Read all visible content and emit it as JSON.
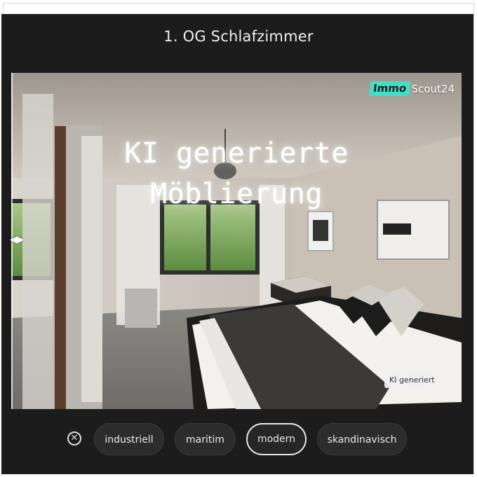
{
  "room": {
    "title": "1. OG Schlafzimmer"
  },
  "photo": {
    "brand_part1": "Immo",
    "brand_part2": "Scout24",
    "overlay_line1": "KI generierte",
    "overlay_line2": "Möblierung",
    "compare_arrows": "◀▶",
    "badge": "KI generiert"
  },
  "styles": {
    "close_icon": "close-circle-icon",
    "close_glyph": "✕",
    "options": [
      {
        "label": "industriell",
        "selected": false
      },
      {
        "label": "maritim",
        "selected": false
      },
      {
        "label": "modern",
        "selected": true
      },
      {
        "label": "skandinavisch",
        "selected": false
      }
    ]
  },
  "colors": {
    "panel": "#1c1c1c",
    "brand_accent": "#3fe0c5"
  }
}
